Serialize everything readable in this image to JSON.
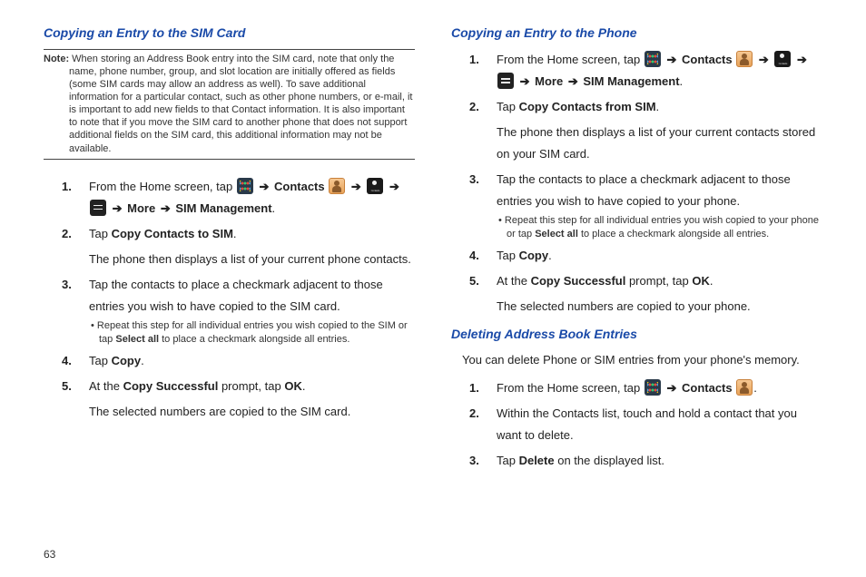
{
  "left": {
    "heading1": "Copying an Entry to the SIM Card",
    "note_label": "Note:",
    "note_body": "When storing an Address Book entry into the SIM card, note that only the name, phone number, group, and slot location are initially offered as fields (some SIM cards may allow an address as well). To save additional information for a particular contact, such as other phone numbers, or e-mail, it is important to add new fields to that Contact information. It is also important to note that if you move the SIM card to another phone that does not support additional fields on the SIM card, this additional information may not be available.",
    "step1_a": "From the Home screen, tap ",
    "step1_b": " Contacts ",
    "step1_c": " More ",
    "step1_d": " SIM Management",
    "step2_a": "Tap ",
    "step2_b": "Copy Contacts to SIM",
    "step2_follow": "The phone then displays a list of your current phone contacts.",
    "step3": "Tap the contacts to place a checkmark adjacent to those entries you wish to have copied to the SIM card.",
    "step3_sub_a": "Repeat this step for all individual entries you wish copied to the SIM or tap ",
    "step3_sub_b": "Select all",
    "step3_sub_c": " to place a checkmark alongside all entries.",
    "step4_a": "Tap ",
    "step4_b": "Copy",
    "step5_a": "At the ",
    "step5_b": "Copy Successful",
    "step5_c": " prompt, tap ",
    "step5_d": "OK",
    "step5_follow": "The selected numbers are copied to the SIM card."
  },
  "right": {
    "heading1": "Copying an Entry to the Phone",
    "r1_a": "From the Home screen, tap ",
    "r1_b": " Contacts ",
    "r1_c": " More ",
    "r1_d": " SIM Management",
    "r2_a": "Tap ",
    "r2_b": "Copy Contacts from SIM",
    "r2_follow": "The phone then displays a list of your current contacts stored on your SIM card.",
    "r3": "Tap the contacts to place a checkmark adjacent to those entries you wish to have copied to your phone.",
    "r3_sub_a": "Repeat this step for all individual entries you wish copied to your phone or tap ",
    "r3_sub_b": "Select all",
    "r3_sub_c": " to place a checkmark alongside all entries.",
    "r4_a": "Tap ",
    "r4_b": "Copy",
    "r5_a": "At the ",
    "r5_b": "Copy Successful",
    "r5_c": " prompt, tap ",
    "r5_d": "OK",
    "r5_follow": "The selected numbers are copied to your phone.",
    "heading2": "Deleting Address Book Entries",
    "intro2": "You can delete Phone or SIM entries from your phone's memory.",
    "d1_a": "From the Home screen, tap ",
    "d1_b": " Contacts ",
    "d2": "Within the Contacts list, touch and hold a contact that you want to delete.",
    "d3_a": "Tap ",
    "d3_b": "Delete",
    "d3_c": " on the displayed list."
  },
  "arrow": "➔",
  "page": "63"
}
